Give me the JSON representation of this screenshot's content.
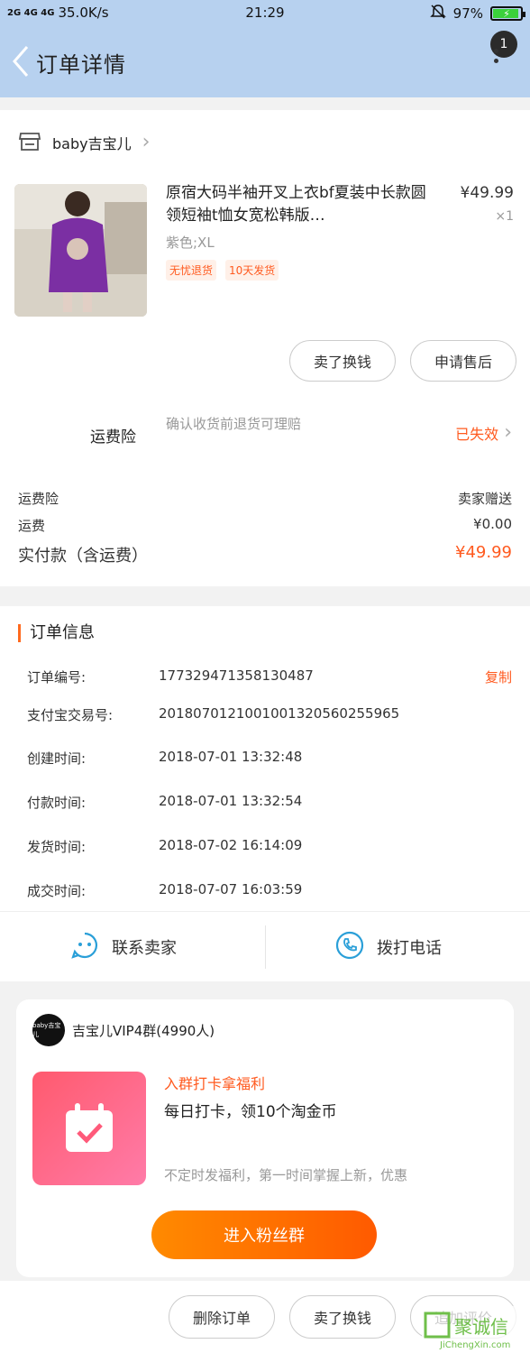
{
  "status_bar": {
    "signal": "2G 4G 4G",
    "speed": "35.0K/s",
    "time": "21:29",
    "battery": "97%"
  },
  "nav": {
    "title": "订单详情",
    "badge": "1"
  },
  "shop": {
    "name": "baby吉宝儿"
  },
  "product": {
    "title": "原宿大码半袖开叉上衣bf夏装中长款圆领短袖t恤女宽松韩版…",
    "price": "¥49.99",
    "qty": "×1",
    "sku": "紫色;XL",
    "tags": [
      "无忧退货",
      "10天发货"
    ]
  },
  "actions": {
    "sell": "卖了换钱",
    "after_sale": "申请售后"
  },
  "insurance": {
    "label": "运费险",
    "desc": "确认收货前退货可理赔",
    "status": "已失效"
  },
  "summary": {
    "rows": [
      {
        "label": "运费险",
        "value": "卖家赠送"
      },
      {
        "label": "运费",
        "value": "¥0.00"
      }
    ],
    "total_label": "实付款（含运费）",
    "total_value": "¥49.99"
  },
  "order_info": {
    "title": "订单信息",
    "copy": "复制",
    "rows": [
      {
        "label": "订单编号:",
        "value": "177329471358130487"
      },
      {
        "label": "支付宝交易号:",
        "value": "2018070121001001320560255965"
      },
      {
        "label": "创建时间:",
        "value": "2018-07-01 13:32:48"
      },
      {
        "label": "付款时间:",
        "value": "2018-07-01 13:32:54"
      },
      {
        "label": "发货时间:",
        "value": "2018-07-02 16:14:09"
      },
      {
        "label": "成交时间:",
        "value": "2018-07-07 16:03:59"
      }
    ],
    "contact_seller": "联系卖家",
    "call": "拨打电话"
  },
  "group": {
    "avatar_text": "baby吉宝儿",
    "name": "吉宝儿VIP4群(4990人)",
    "t1": "入群打卡拿福利",
    "t2": "每日打卡，领10个淘金币",
    "t3": "不定时发福利，第一时间掌握上新，优惠",
    "join": "进入粉丝群"
  },
  "bottom": {
    "delete": "删除订单",
    "sell": "卖了换钱",
    "review": "追加评价"
  },
  "watermark": {
    "brand": "聚诚信",
    "url": "JiChengXin.com"
  },
  "colors": {
    "accent": "#ff5a1f",
    "header_bg": "#b7d1ef",
    "icon_blue": "#2a9fd8"
  }
}
